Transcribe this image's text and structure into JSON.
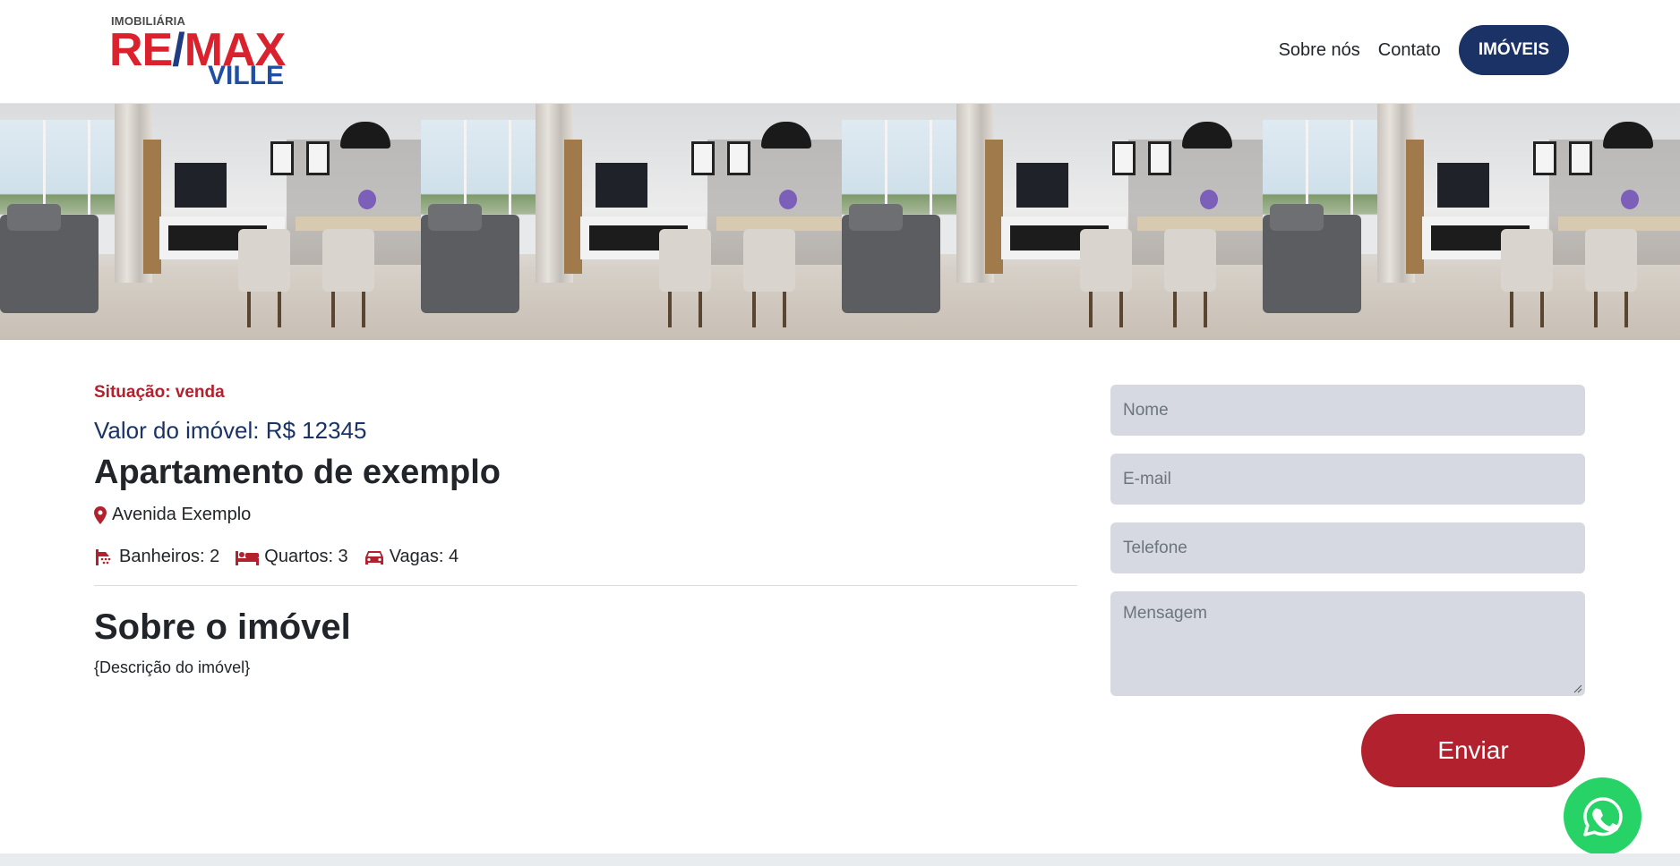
{
  "header": {
    "logo": {
      "small": "IMOBILIÁRIA",
      "main_left": "RE",
      "main_slash": "/",
      "main_right": "MAX",
      "sub": "VILLE"
    },
    "nav": {
      "sobre": "Sobre nós",
      "contato": "Contato",
      "imoveis": "IMÓVEIS"
    }
  },
  "property": {
    "situacao": "Situação: venda",
    "valor": "Valor do imóvel: R$ 12345",
    "title": "Apartamento de exemplo",
    "address": "Avenida Exemplo",
    "features": {
      "banheiros": "Banheiros: 2",
      "quartos": "Quartos: 3",
      "vagas": "Vagas: 4"
    },
    "sobre_title": "Sobre o imóvel",
    "sobre_desc": "{Descrição do imóvel}"
  },
  "form": {
    "nome_placeholder": "Nome",
    "email_placeholder": "E-mail",
    "telefone_placeholder": "Telefone",
    "mensagem_placeholder": "Mensagem",
    "submit": "Enviar"
  },
  "colors": {
    "brand_red": "#b1222e",
    "brand_blue": "#1a3266",
    "whatsapp_green": "#27d366",
    "input_bg": "#d6d9e1"
  },
  "icons": {
    "address": "map-marker-icon",
    "banheiros": "shower-icon",
    "quartos": "bed-icon",
    "vagas": "car-icon",
    "whatsapp": "whatsapp-icon"
  }
}
